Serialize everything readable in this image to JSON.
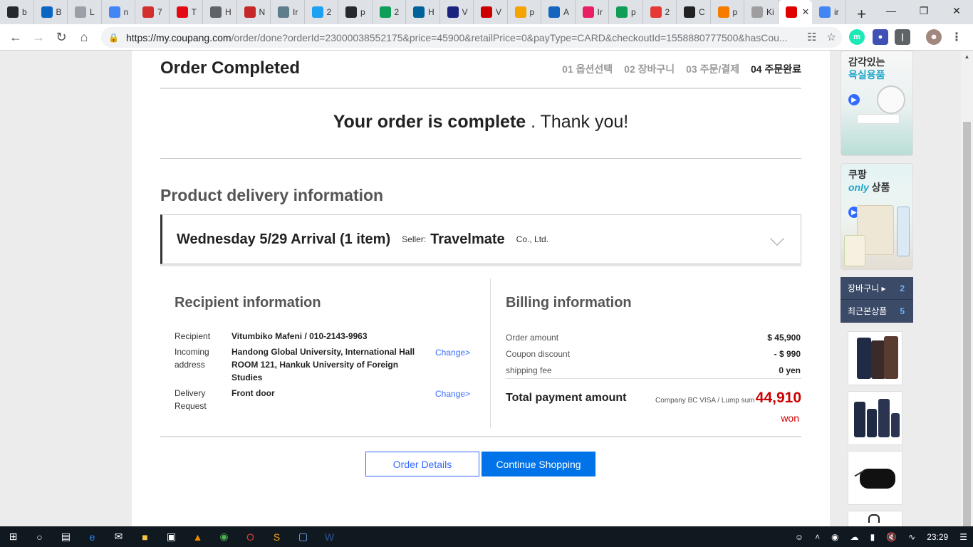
{
  "browser": {
    "tabs": [
      {
        "letter": "b",
        "color": "#24292e",
        "icon": "github-icon"
      },
      {
        "letter": "B",
        "color": "#0a66c2",
        "icon": "b-app-icon"
      },
      {
        "letter": "L",
        "color": "#9aa0a6",
        "icon": "globe-icon"
      },
      {
        "letter": "n",
        "color": "#4285f4",
        "icon": "google-icon"
      },
      {
        "letter": "7",
        "color": "#d32f2f",
        "icon": "vivaldi-icon"
      },
      {
        "letter": "T",
        "color": "#e50914",
        "icon": "netflix-icon"
      },
      {
        "letter": "H",
        "color": "#5f6368",
        "icon": "google-icon"
      },
      {
        "letter": "N",
        "color": "#c62828",
        "icon": "red-logo-icon"
      },
      {
        "letter": "Ir",
        "color": "#607d8b",
        "icon": "tree-icon"
      },
      {
        "letter": "2",
        "color": "#1da1f2",
        "icon": "bird-icon"
      },
      {
        "letter": "p",
        "color": "#24292e",
        "icon": "github-icon"
      },
      {
        "letter": "2",
        "color": "#0f9d58",
        "icon": "drive-icon"
      },
      {
        "letter": "H",
        "color": "#00629b",
        "icon": "ieee-icon"
      },
      {
        "letter": "V",
        "color": "#1a237e",
        "icon": "triangle-icon"
      },
      {
        "letter": "V",
        "color": "#cc0000",
        "icon": "opera-icon"
      },
      {
        "letter": "p",
        "color": "#f4a300",
        "icon": "pma-icon"
      },
      {
        "letter": "A",
        "color": "#1565c0",
        "icon": "cap-icon"
      },
      {
        "letter": "Ir",
        "color": "#e91e63",
        "icon": "app-icon"
      },
      {
        "letter": "p",
        "color": "#0f9d58",
        "icon": "drive-icon"
      },
      {
        "letter": "2",
        "color": "#e53935",
        "icon": "pdf-icon"
      },
      {
        "letter": "C",
        "color": "#222222",
        "icon": "codepen-icon"
      },
      {
        "letter": "p",
        "color": "#f57c00",
        "icon": "stack-icon"
      },
      {
        "letter": "Ki",
        "color": "#9e9e9e",
        "icon": "blank-icon"
      },
      {
        "letter": "",
        "color": "#e00000",
        "icon": "adobe-icon",
        "active": true
      },
      {
        "letter": "ir",
        "color": "#4285f4",
        "icon": "google-icon"
      }
    ],
    "url_host": "https://my.coupang.com",
    "url_path": "/order/done?orderId=23000038552175&price=45900&retailPrice=0&payType=CARD&checkoutId=1558880777500&hasCou..."
  },
  "header": {
    "title": "Order Completed",
    "steps": [
      "01 옵션선택",
      "02 장바구니",
      "03 주문/결제",
      "04 주문완료"
    ]
  },
  "complete": {
    "bold": "Your order is complete",
    "rest": " . Thank you!"
  },
  "delivery": {
    "section_title": "Product delivery information",
    "arrival": "Wednesday 5/29 Arrival (1 item)",
    "seller_label": "Seller:",
    "seller_name": "Travelmate",
    "seller_suffix": "Co., Ltd."
  },
  "recipient": {
    "title": "Recipient information",
    "recipient_label": "Recipient",
    "recipient_value": "Vitumbiko Mafeni / 010-2143-9963",
    "address_label": "Incoming address",
    "address_value": "Handong Global University, International Hall ROOM 121, Hankuk University of Foreign Studies",
    "request_label": "Delivery Request",
    "request_value": "Front door",
    "change_label": "Change>"
  },
  "billing": {
    "title": "Billing information",
    "order_amount_label": "Order amount",
    "order_amount": "$ 45,900",
    "coupon_label": "Coupon discount",
    "coupon": "- $ 990",
    "shipping_label": "shipping fee",
    "shipping": "0 yen",
    "total_label": "Total payment amount",
    "total_method": "Company BC VISA / Lump sum",
    "total_amount": "44,910",
    "total_unit": "won"
  },
  "buttons": {
    "order_details": "Order Details",
    "continue_shopping": "Continue Shopping"
  },
  "rail": {
    "banner1_line1": "감각있는",
    "banner1_line2": "욕실용품",
    "banner2_line1": "쿠팡",
    "banner2_only": "only",
    "banner2_rest": " 상품",
    "cart_label": "장바구니 ▸",
    "cart_count": "2",
    "recent_label": "최근본상품",
    "recent_count": "5"
  },
  "taskbar": {
    "time": "23:29"
  }
}
